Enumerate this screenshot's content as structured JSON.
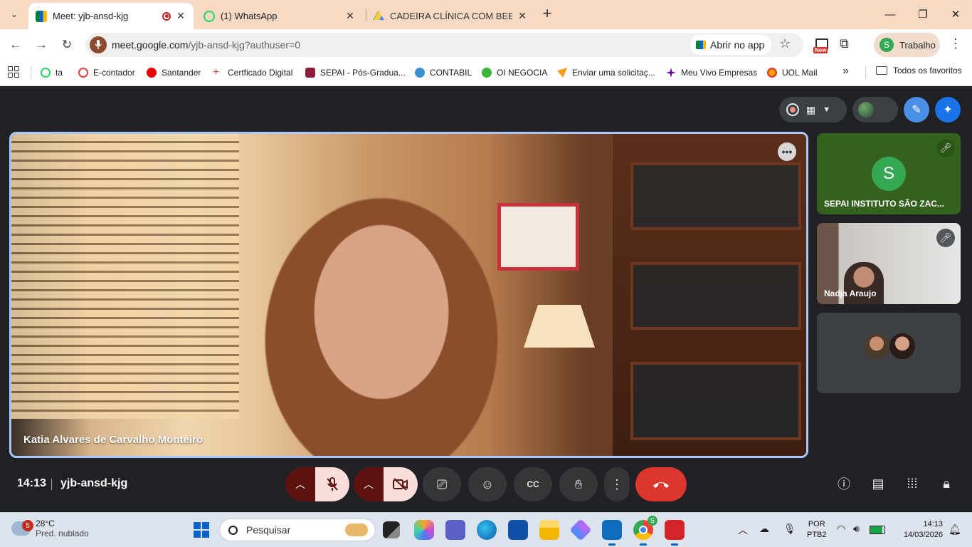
{
  "browser": {
    "tabs": [
      {
        "title": "Meet: yjb-ansd-kjg",
        "active": true,
        "recording": true
      },
      {
        "title": "(1) WhatsApp",
        "active": false
      },
      {
        "title": "CADEIRA CLÍNICA COM BEBÊS :",
        "active": false
      }
    ],
    "url_host": "meet.google.com",
    "url_path": "/yjb-ansd-kjg?authuser=0",
    "open_in_app_label": "Abrir no app",
    "extension_badge": "New",
    "profile_initial": "S",
    "profile_name": "Trabalho"
  },
  "bookmarks": {
    "items": [
      {
        "label": "ta",
        "color": "#25d366"
      },
      {
        "label": "E-contador",
        "color": "#e5413a"
      },
      {
        "label": "Santander",
        "color": "#ec0000"
      },
      {
        "label": "Certficado Digital",
        "color": "#d6453c"
      },
      {
        "label": "SEPAI - Pós-Gradua...",
        "color": "#8c1c3a"
      },
      {
        "label": "CONTABIL",
        "color": "#3a8fd1"
      },
      {
        "label": "OI NEGOCIA",
        "color": "#3ab43a"
      },
      {
        "label": "Enviar uma solicitaç...",
        "color": "#f29d1f"
      },
      {
        "label": "Meu Vivo Empresas",
        "color": "#660099"
      },
      {
        "label": "UOL Mail",
        "color": "#f7a600"
      }
    ],
    "all_favorites": "Todos os favoritos"
  },
  "meet": {
    "main_participant": "Katia Alvares de Carvalho Monteiro",
    "side_tiles": [
      {
        "name": "SEPAI INSTITUTO SÃO ZAC...",
        "initial": "S",
        "muted": true
      },
      {
        "name": "Nadja Araujo",
        "muted": true
      }
    ],
    "time": "14:13",
    "meeting_code": "yjb-ansd-kjg"
  },
  "taskbar": {
    "weather_badge": "5",
    "temperature": "28°C",
    "weather_desc": "Pred. nublado",
    "search_placeholder": "Pesquisar",
    "lang_1": "POR",
    "lang_2": "PTB2",
    "time": "14:13",
    "date": "14/03/2026",
    "chrome_badge": "S"
  }
}
